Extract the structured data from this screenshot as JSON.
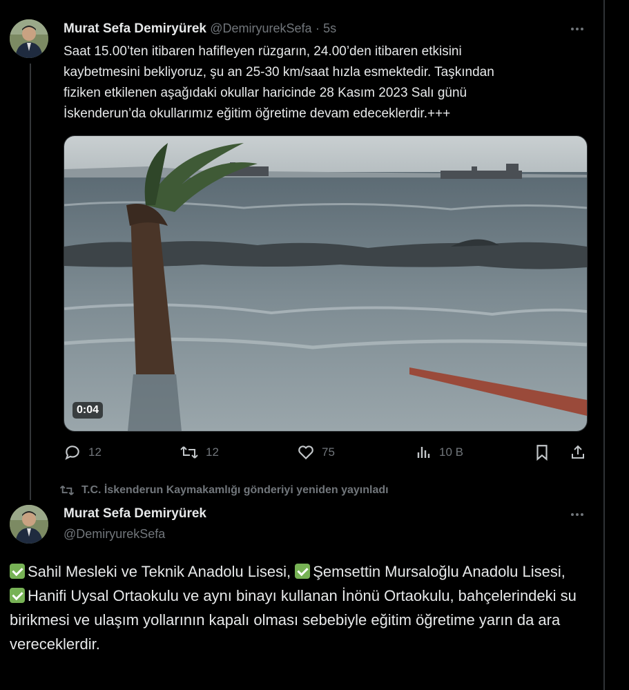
{
  "tweet1": {
    "author_name": "Murat Sefa Demiryürek",
    "handle": "@DemiryurekSefa",
    "separator": "·",
    "time": "5s",
    "text": "Saat 15.00’ten itibaren hafifleyen rüzgarın, 24.00’den itibaren etkisini\nkaybetmesini bekliyoruz, şu an 25-30 km/saat hızla esmektedir. Taşkından\nfiziken etkilenen aşağıdaki okullar haricinde 28 Kasım 2023 Salı günü\nİskenderun’da okullarımız eğitim öğretime devam edeceklerdir.+++",
    "video_duration": "0:04",
    "replies": "12",
    "retweets": "12",
    "likes": "75",
    "views": "10 B",
    "icons": [
      "more-icon",
      "reply-icon",
      "retweet-icon",
      "like-icon",
      "views-icon",
      "bookmark-icon",
      "share-icon"
    ]
  },
  "retweet_notice": {
    "text": "T.C. İskenderun Kaymakamlığı gönderiyi yeniden yayınladı"
  },
  "tweet2": {
    "author_name": "Murat Sefa Demiryürek",
    "handle": "@DemiryurekSefa",
    "line1a": "Sahil Mesleki ve Teknik Anadolu Lisesi, ",
    "line1b": "Şemsettin Mursaloğlu Anadolu Lisesi,",
    "line2": "Hanifi Uysal Ortaokulu ve aynı binayı kullanan İnönü Ortaokulu, bahçelerindeki su birikmesi ve ulaşım yollarının kapalı olması sebebiyle eğitim öğretime yarın da ara vereceklerdir."
  },
  "colors": {
    "background": "#000000",
    "text": "#e7e9ea",
    "muted": "#71767b",
    "check_emoji": "#77b255"
  }
}
